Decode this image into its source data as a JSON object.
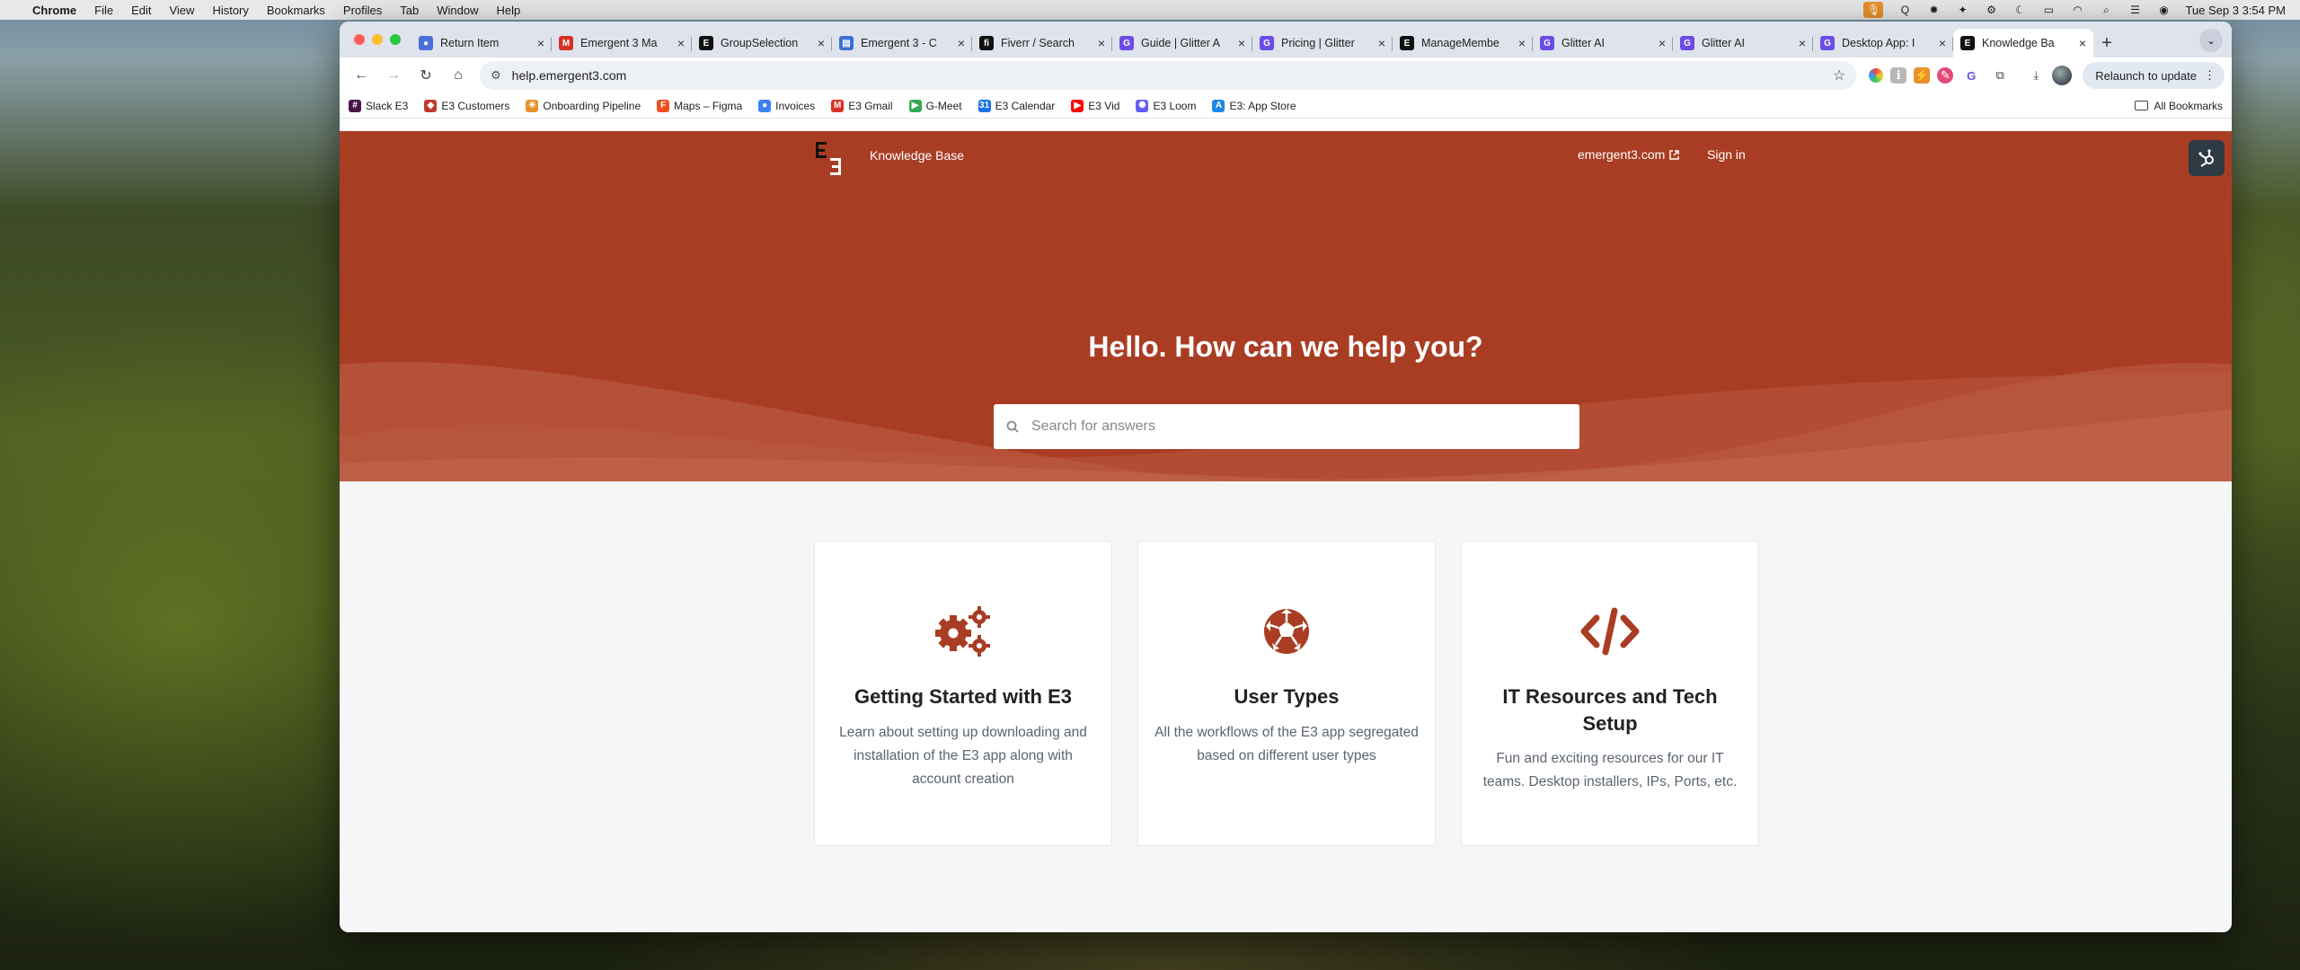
{
  "menubar": {
    "app": "Chrome",
    "items": [
      "File",
      "Edit",
      "View",
      "History",
      "Bookmarks",
      "Profiles",
      "Tab",
      "Window",
      "Help"
    ],
    "clock": "Tue Sep 3  3:54 PM"
  },
  "tabs": [
    {
      "title": "Return Item",
      "color": "#4a6fd8",
      "glyph": "●"
    },
    {
      "title": "Emergent 3 Ma",
      "color": "#d93025",
      "glyph": "M"
    },
    {
      "title": "GroupSelection",
      "color": "#111111",
      "glyph": "E"
    },
    {
      "title": "Emergent 3 - C",
      "color": "#3b6fd4",
      "glyph": "▤"
    },
    {
      "title": "Fiverr / Search",
      "color": "#111111",
      "glyph": "fi"
    },
    {
      "title": "Guide | Glitter A",
      "color": "#6b4ce6",
      "glyph": "G"
    },
    {
      "title": "Pricing | Glitter",
      "color": "#6b4ce6",
      "glyph": "G"
    },
    {
      "title": "ManageMembe",
      "color": "#111111",
      "glyph": "E"
    },
    {
      "title": "Glitter AI",
      "color": "#6b4ce6",
      "glyph": "G"
    },
    {
      "title": "Glitter AI",
      "color": "#6b4ce6",
      "glyph": "G"
    },
    {
      "title": "Desktop App: I",
      "color": "#6b4ce6",
      "glyph": "G"
    },
    {
      "title": "Knowledge Ba",
      "color": "#111111",
      "glyph": "E",
      "active": true
    }
  ],
  "toolbar": {
    "url": "help.emergent3.com",
    "relaunch": "Relaunch to update"
  },
  "bookmarks": [
    {
      "label": "Slack  E3",
      "color": "#4a154b",
      "glyph": "#"
    },
    {
      "label": "E3 Customers",
      "color": "#c0392b",
      "glyph": "◆"
    },
    {
      "label": "Onboarding Pipeline",
      "color": "#e8912c",
      "glyph": "✳"
    },
    {
      "label": "Maps – Figma",
      "color": "#f24e1e",
      "glyph": "F"
    },
    {
      "label": "Invoices",
      "color": "#3b82f6",
      "glyph": "●"
    },
    {
      "label": "E3 Gmail",
      "color": "#d93025",
      "glyph": "M"
    },
    {
      "label": "G-Meet",
      "color": "#34a853",
      "glyph": "▶"
    },
    {
      "label": "E3 Calendar",
      "color": "#1a73e8",
      "glyph": "31"
    },
    {
      "label": "E3 Vid",
      "color": "#ff0000",
      "glyph": "▶"
    },
    {
      "label": "E3 Loom",
      "color": "#625df5",
      "glyph": "✺"
    },
    {
      "label": "E3: App Store",
      "color": "#1e88e5",
      "glyph": "A"
    }
  ],
  "bookmarks_all": "All Bookmarks",
  "site": {
    "brand_color": "#a93d24",
    "kb_label": "Knowledge Base",
    "external_link": "emergent3.com",
    "signin": "Sign in",
    "headline": "Hello. How can we help you?",
    "search_placeholder": "Search for answers"
  },
  "cards": [
    {
      "icon": "gears-icon",
      "title": "Getting Started with E3",
      "description": "Learn about setting up downloading and installation of the E3 app along with account creation"
    },
    {
      "icon": "soccer-ball-icon",
      "title": "User Types",
      "description": "All the workflows of the E3 app segregated based on different user types"
    },
    {
      "icon": "code-icon",
      "title": "IT Resources and Tech Setup",
      "description": "Fun and exciting resources for our IT teams. Desktop installers, IPs, Ports, etc."
    }
  ]
}
